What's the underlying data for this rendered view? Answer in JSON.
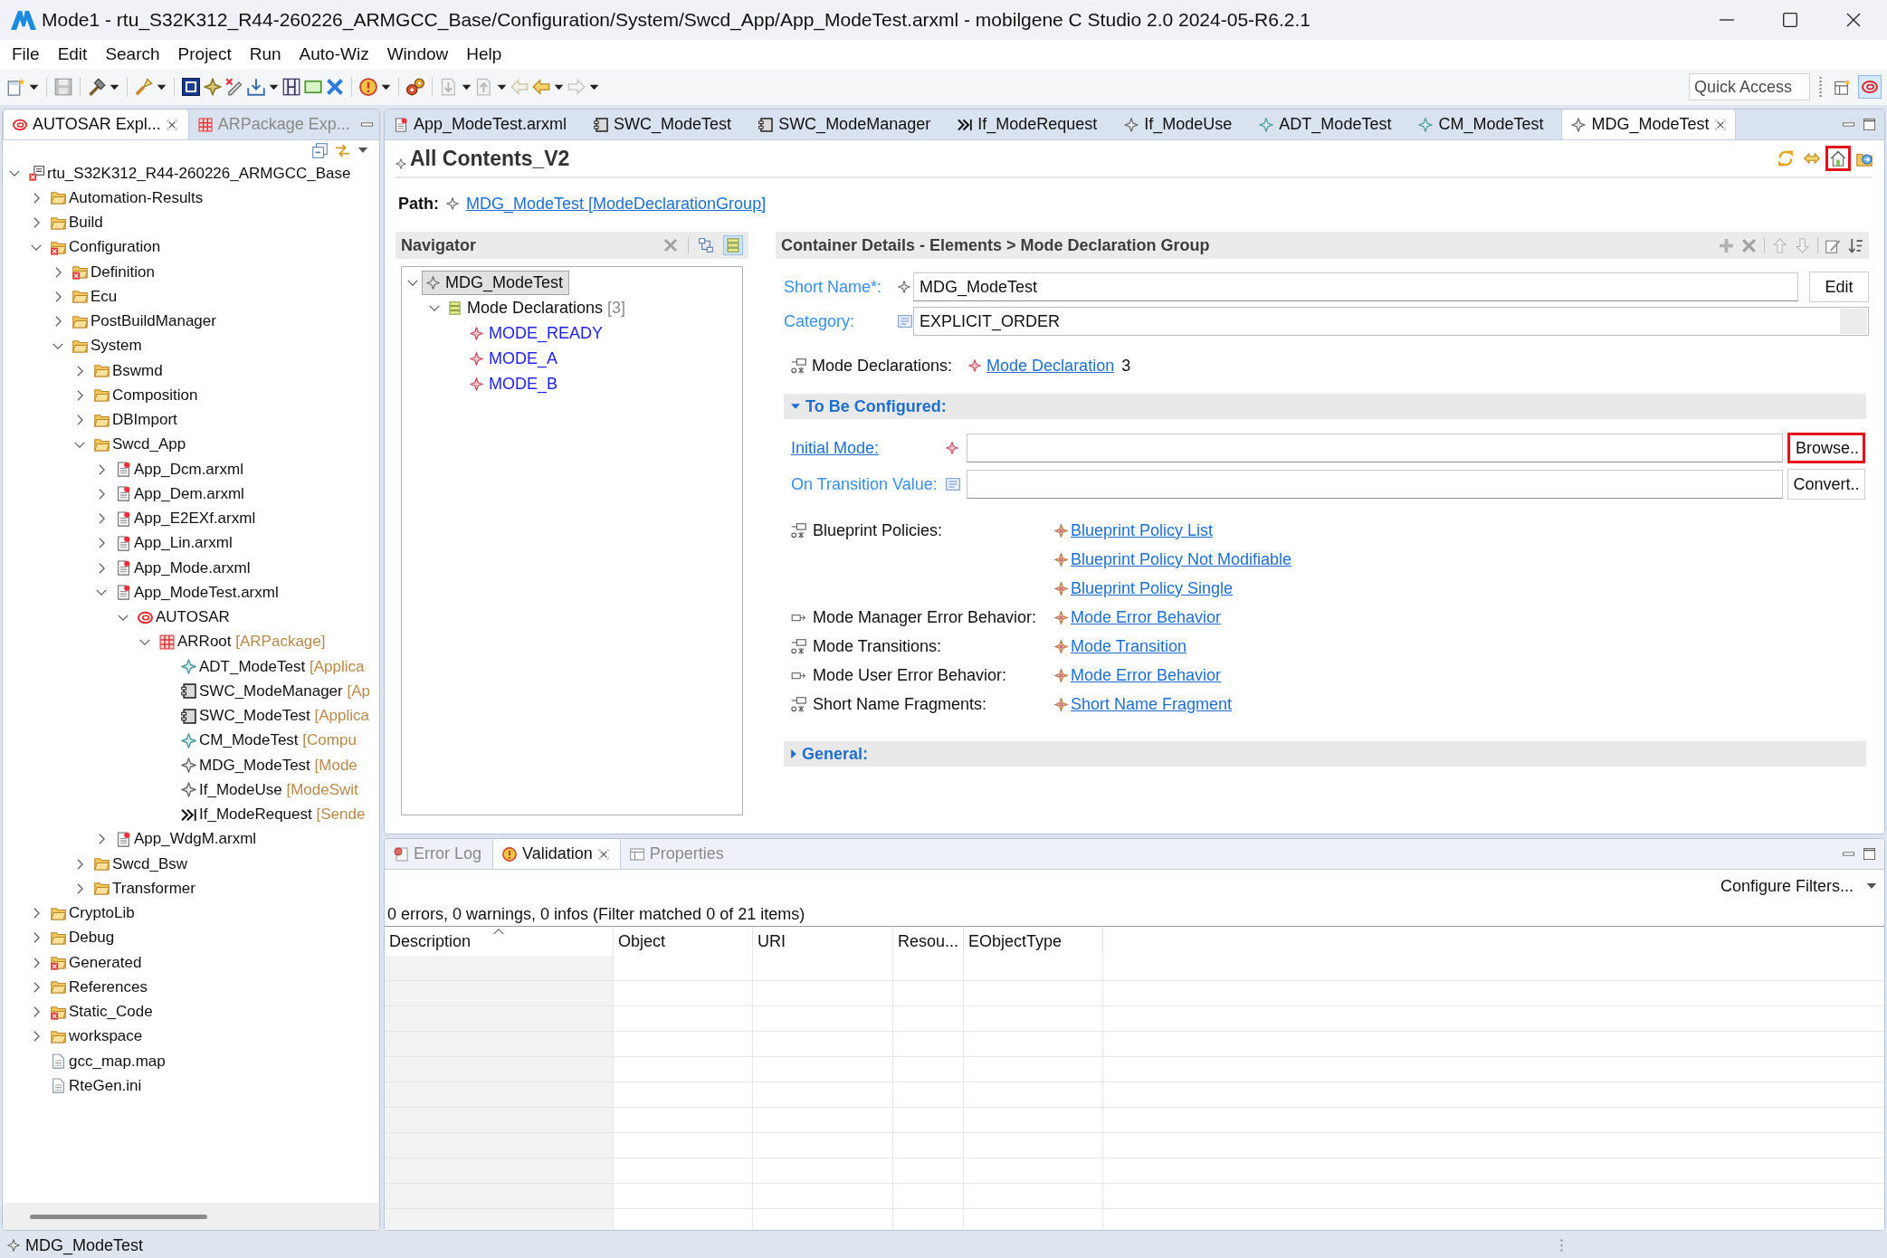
{
  "window": {
    "title": "Mode1 - rtu_S32K312_R44-260226_ARMGCC_Base/Configuration/System/Swcd_App/App_ModeTest.arxml - mobilgene C Studio 2.0 2024-05-R6.2.1"
  },
  "menu": [
    "File",
    "Edit",
    "Search",
    "Project",
    "Run",
    "Auto-Wiz",
    "Window",
    "Help"
  ],
  "toolbar": {
    "quick_access": {
      "placeholder": "Quick Access"
    },
    "perspectives": [
      {
        "kind": "open",
        "selected": false
      },
      {
        "kind": "autosar",
        "selected": true
      }
    ]
  },
  "explorer": {
    "tabs": [
      {
        "label": "AUTOSAR Expl...",
        "kind": "autosar",
        "selected": true
      },
      {
        "label": "ARPackage Exp...",
        "kind": "package",
        "selected": false
      }
    ],
    "tree": [
      {
        "label": "rtu_S32K312_R44-260226_ARMGCC_Base",
        "kind": "project",
        "expanded": true,
        "children": [
          {
            "label": "Automation-Results",
            "kind": "folder",
            "expanded": false
          },
          {
            "label": "Build",
            "kind": "folder",
            "expanded": false
          },
          {
            "label": "Configuration",
            "kind": "config-folder",
            "expanded": true,
            "children": [
              {
                "label": "Definition",
                "kind": "config-folder",
                "expanded": false
              },
              {
                "label": "Ecu",
                "kind": "folder",
                "expanded": false
              },
              {
                "label": "PostBuildManager",
                "kind": "folder",
                "expanded": false
              },
              {
                "label": "System",
                "kind": "folder",
                "expanded": true,
                "children": [
                  {
                    "label": "Bswmd",
                    "kind": "folder",
                    "expanded": false
                  },
                  {
                    "label": "Composition",
                    "kind": "folder",
                    "expanded": false
                  },
                  {
                    "label": "DBImport",
                    "kind": "folder",
                    "expanded": false
                  },
                  {
                    "label": "Swcd_App",
                    "kind": "folder",
                    "expanded": true,
                    "children": [
                      {
                        "label": "App_Dcm.arxml",
                        "kind": "file",
                        "expanded": false
                      },
                      {
                        "label": "App_Dem.arxml",
                        "kind": "file",
                        "expanded": false
                      },
                      {
                        "label": "App_E2EXf.arxml",
                        "kind": "file",
                        "expanded": false
                      },
                      {
                        "label": "App_Lin.arxml",
                        "kind": "file",
                        "expanded": false
                      },
                      {
                        "label": "App_Mode.arxml",
                        "kind": "file",
                        "expanded": false
                      },
                      {
                        "label": "App_ModeTest.arxml",
                        "kind": "file",
                        "expanded": true,
                        "children": [
                          {
                            "label": "AUTOSAR",
                            "kind": "autosar",
                            "expanded": true,
                            "children": [
                              {
                                "label": "ARRoot",
                                "suffix": "[ARPackage]",
                                "kind": "package",
                                "expanded": true,
                                "children": [
                                  {
                                    "label": "ADT_ModeTest",
                                    "suffix": "[Applica",
                                    "kind": "type"
                                  },
                                  {
                                    "label": "SWC_ModeManager",
                                    "suffix": "[Ap",
                                    "kind": "component"
                                  },
                                  {
                                    "label": "SWC_ModeTest",
                                    "suffix": "[Applica",
                                    "kind": "component"
                                  },
                                  {
                                    "label": "CM_ModeTest",
                                    "suffix": "[Compu",
                                    "kind": "type"
                                  },
                                  {
                                    "label": "MDG_ModeTest",
                                    "suffix": "[Mode",
                                    "kind": "element"
                                  },
                                  {
                                    "label": "If_ModeUse",
                                    "suffix": "[ModeSwit",
                                    "kind": "element"
                                  },
                                  {
                                    "label": "If_ModeRequest",
                                    "suffix": "[Sende",
                                    "kind": "interface"
                                  }
                                ]
                              }
                            ]
                          }
                        ]
                      },
                      {
                        "label": "App_WdgM.arxml",
                        "kind": "file",
                        "expanded": false
                      }
                    ]
                  },
                  {
                    "label": "Swcd_Bsw",
                    "kind": "folder",
                    "expanded": false
                  },
                  {
                    "label": "Transformer",
                    "kind": "folder",
                    "expanded": false
                  }
                ]
              }
            ]
          },
          {
            "label": "CryptoLib",
            "kind": "folder",
            "expanded": false
          },
          {
            "label": "Debug",
            "kind": "folder",
            "expanded": false
          },
          {
            "label": "Generated",
            "kind": "config-folder",
            "expanded": false
          },
          {
            "label": "References",
            "kind": "folder",
            "expanded": false
          },
          {
            "label": "Static_Code",
            "kind": "config-folder",
            "expanded": false
          },
          {
            "label": "workspace",
            "kind": "folder",
            "expanded": false
          },
          {
            "label": "gcc_map.map",
            "kind": "plain-file"
          },
          {
            "label": "RteGen.ini",
            "kind": "plain-file"
          }
        ]
      }
    ]
  },
  "editor": {
    "tabs": [
      {
        "label": "App_ModeTest.arxml",
        "kind": "file",
        "selected": false
      },
      {
        "label": "SWC_ModeTest",
        "kind": "component",
        "selected": false
      },
      {
        "label": "SWC_ModeManager",
        "kind": "component",
        "selected": false
      },
      {
        "label": "If_ModeRequest",
        "kind": "interface",
        "selected": false
      },
      {
        "label": "If_ModeUse",
        "kind": "element",
        "selected": false
      },
      {
        "label": "ADT_ModeTest",
        "kind": "type",
        "selected": false
      },
      {
        "label": "CM_ModeTest",
        "kind": "type",
        "selected": false
      },
      {
        "label": "MDG_ModeTest",
        "kind": "element",
        "selected": true
      }
    ],
    "title": "All Contents_V2",
    "tools": [
      {
        "kind": "sync",
        "highlighted": false
      },
      {
        "kind": "swap",
        "highlighted": false
      },
      {
        "kind": "home",
        "highlighted": true
      },
      {
        "kind": "import",
        "highlighted": false
      }
    ],
    "path": {
      "label": "Path:",
      "link": "MDG_ModeTest [ModeDeclarationGroup]"
    },
    "navigator": {
      "title": "Navigator",
      "tools": [
        {
          "kind": "remove",
          "on": false
        },
        {
          "kind": "layout",
          "on": false
        },
        {
          "kind": "list",
          "on": true
        }
      ],
      "tree": [
        {
          "label": "MDG_ModeTest",
          "kind": "element",
          "expanded": true,
          "selected": true,
          "children": [
            {
              "label": "Mode Declarations",
              "suffix": "[3]",
              "kind": "list",
              "expanded": true,
              "selected": false,
              "children": [
                {
                  "label": "MODE_READY",
                  "kind": "mode",
                  "selected": false
                },
                {
                  "label": "MODE_A",
                  "kind": "mode",
                  "selected": false
                },
                {
                  "label": "MODE_B",
                  "kind": "mode",
                  "selected": false
                }
              ]
            }
          ]
        }
      ]
    },
    "details": {
      "title": "Container Details - Elements > Mode Declaration Group",
      "fields": [
        {
          "kind": "text",
          "label": "Short Name*:",
          "value": "MDG_ModeTest",
          "button": "Edit"
        },
        {
          "kind": "combo",
          "label": "Category:",
          "value": "EXPLICIT_ORDER"
        }
      ],
      "declarations": {
        "label": "Mode Declarations:",
        "link": "Mode Declaration",
        "count": "3"
      },
      "sections": [
        {
          "title": "To Be Configured:",
          "expanded": true,
          "fields": [
            {
              "kind": "reference",
              "label": "Initial Mode:",
              "button": "Browse..",
              "highlighted": true
            },
            {
              "kind": "value",
              "label": "On Transition Value:",
              "button": "Convert..",
              "highlighted": false
            }
          ],
          "references": [
            {
              "kind": "many",
              "label": "Blueprint Policies:",
              "links": [
                "Blueprint Policy List",
                "Blueprint Policy Not Modifiable",
                "Blueprint Policy Single"
              ]
            },
            {
              "kind": "single",
              "label": "Mode Manager Error Behavior:",
              "links": [
                "Mode Error Behavior"
              ]
            },
            {
              "kind": "many",
              "label": "Mode Transitions:",
              "links": [
                "Mode Transition"
              ]
            },
            {
              "kind": "single",
              "label": "Mode User Error Behavior:",
              "links": [
                "Mode Error Behavior"
              ]
            },
            {
              "kind": "many",
              "label": "Short Name Fragments:",
              "links": [
                "Short Name Fragment"
              ]
            }
          ]
        },
        {
          "title": "General:",
          "expanded": false
        }
      ]
    }
  },
  "problems": {
    "tabs": [
      {
        "label": "Error Log",
        "kind": "error-log",
        "selected": false
      },
      {
        "label": "Validation",
        "kind": "validation",
        "selected": true
      },
      {
        "label": "Properties",
        "kind": "properties",
        "selected": false
      }
    ],
    "filter_link": "Configure Filters...",
    "summary": "0 errors, 0 warnings, 0 infos (Filter matched 0 of 21 items)",
    "columns": [
      {
        "label": "Description",
        "sorted": true
      },
      {
        "label": "Object",
        "sorted": false
      },
      {
        "label": "URI",
        "sorted": false
      },
      {
        "label": "Resou...",
        "sorted": false
      },
      {
        "label": "EObjectType",
        "sorted": false
      }
    ]
  },
  "status_bar": {
    "text": "MDG_ModeTest"
  }
}
